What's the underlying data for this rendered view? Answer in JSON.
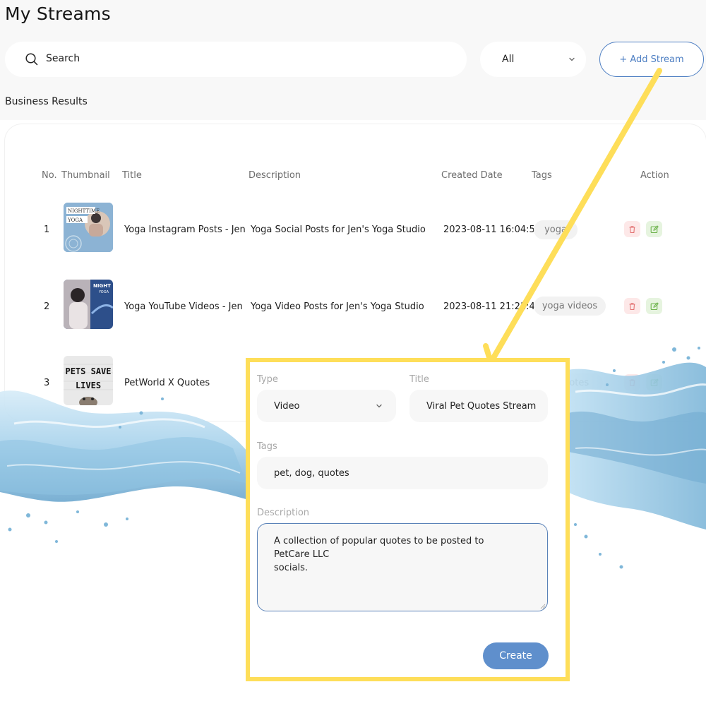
{
  "page": {
    "title": "My Streams",
    "section_heading": "Business Results"
  },
  "toolbar": {
    "search_placeholder": "Search",
    "filter_value": "All",
    "add_stream_label": "+ Add Stream"
  },
  "table": {
    "columns": [
      "No.",
      "Thumbnail",
      "Title",
      "Description",
      "Created Date",
      "Tags",
      "Action"
    ],
    "rows": [
      {
        "no": "1",
        "thumbnail_text": [
          "NIGHTTIME",
          "YOGA"
        ],
        "title": "Yoga Instagram Posts - Jen",
        "description": "Yoga Social Posts for Jen's Yoga Studio",
        "created": "2023-08-11 16:04:58",
        "tag": "yoga"
      },
      {
        "no": "2",
        "thumbnail_text": [
          "NIGHT",
          "YOGA"
        ],
        "title": "Yoga YouTube Videos - Jen",
        "description": "Yoga Video Posts for Jen's Yoga Studio",
        "created": "2023-08-11 21:21:49",
        "tag": "yoga videos"
      },
      {
        "no": "3",
        "thumbnail_text": [
          "PETS SAVE",
          "LIVES"
        ],
        "title": "PetWorld X Quotes",
        "description": "",
        "created": "",
        "tag": "quotes"
      }
    ]
  },
  "dialog": {
    "type_label": "Type",
    "type_value": "Video",
    "title_label": "Title",
    "title_value": "Viral Pet Quotes Stream",
    "tags_label": "Tags",
    "tags_value": "pet, dog, quotes",
    "description_label": "Description",
    "description_value": "A collection of popular quotes to be posted to PetCare LLC\nsocials.",
    "create_label": "Create"
  },
  "colors": {
    "accent_blue": "#4e7fc3",
    "highlight_yellow": "#fede59",
    "delete_bg": "#fde8e8",
    "edit_bg": "#e6f4df"
  },
  "icons": [
    "search-icon",
    "chevron-down-icon",
    "trash-icon",
    "edit-icon"
  ]
}
